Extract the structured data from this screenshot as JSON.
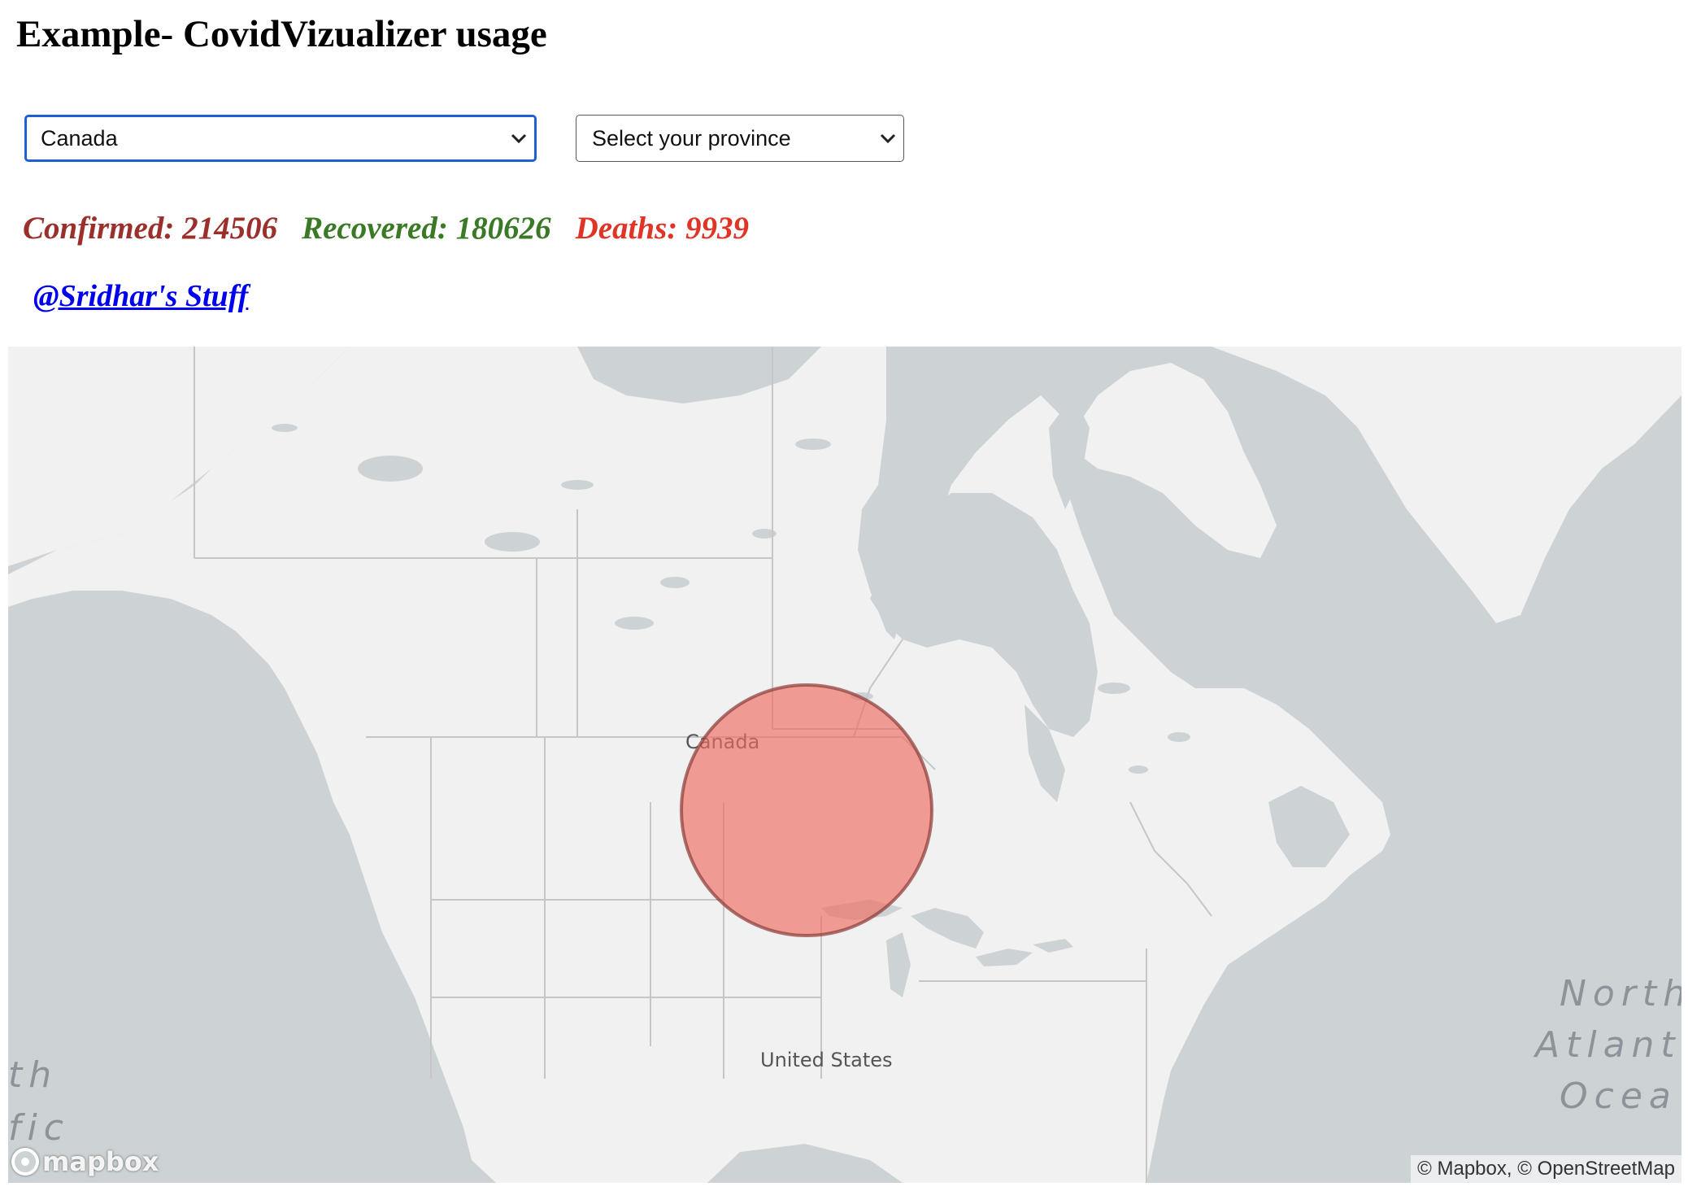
{
  "page": {
    "title": "Example- CovidVizualizer usage"
  },
  "selectors": {
    "country": {
      "value": "Canada"
    },
    "province": {
      "value": "Select your province"
    }
  },
  "stats": {
    "confirmed": "Confirmed: 214506",
    "recovered": "Recovered: 180626",
    "deaths": "Deaths: 9939"
  },
  "link": {
    "label": "@Sridhar's Stuff"
  },
  "map": {
    "labels": {
      "country": "Canada",
      "us": "United States",
      "atlantic": [
        "North",
        "Atlant",
        "Ocea"
      ],
      "pacific": [
        "th",
        "fic"
      ]
    },
    "marker": {
      "color": "#ee6b61",
      "stroke": "#8a3a36",
      "country": "Canada"
    },
    "logo": "mapbox",
    "attribution": "© Mapbox, © OpenStreetMap",
    "colors": {
      "water": "#cdd3d5",
      "land": "#f1f1f1",
      "border": "#c8c8c8"
    }
  }
}
